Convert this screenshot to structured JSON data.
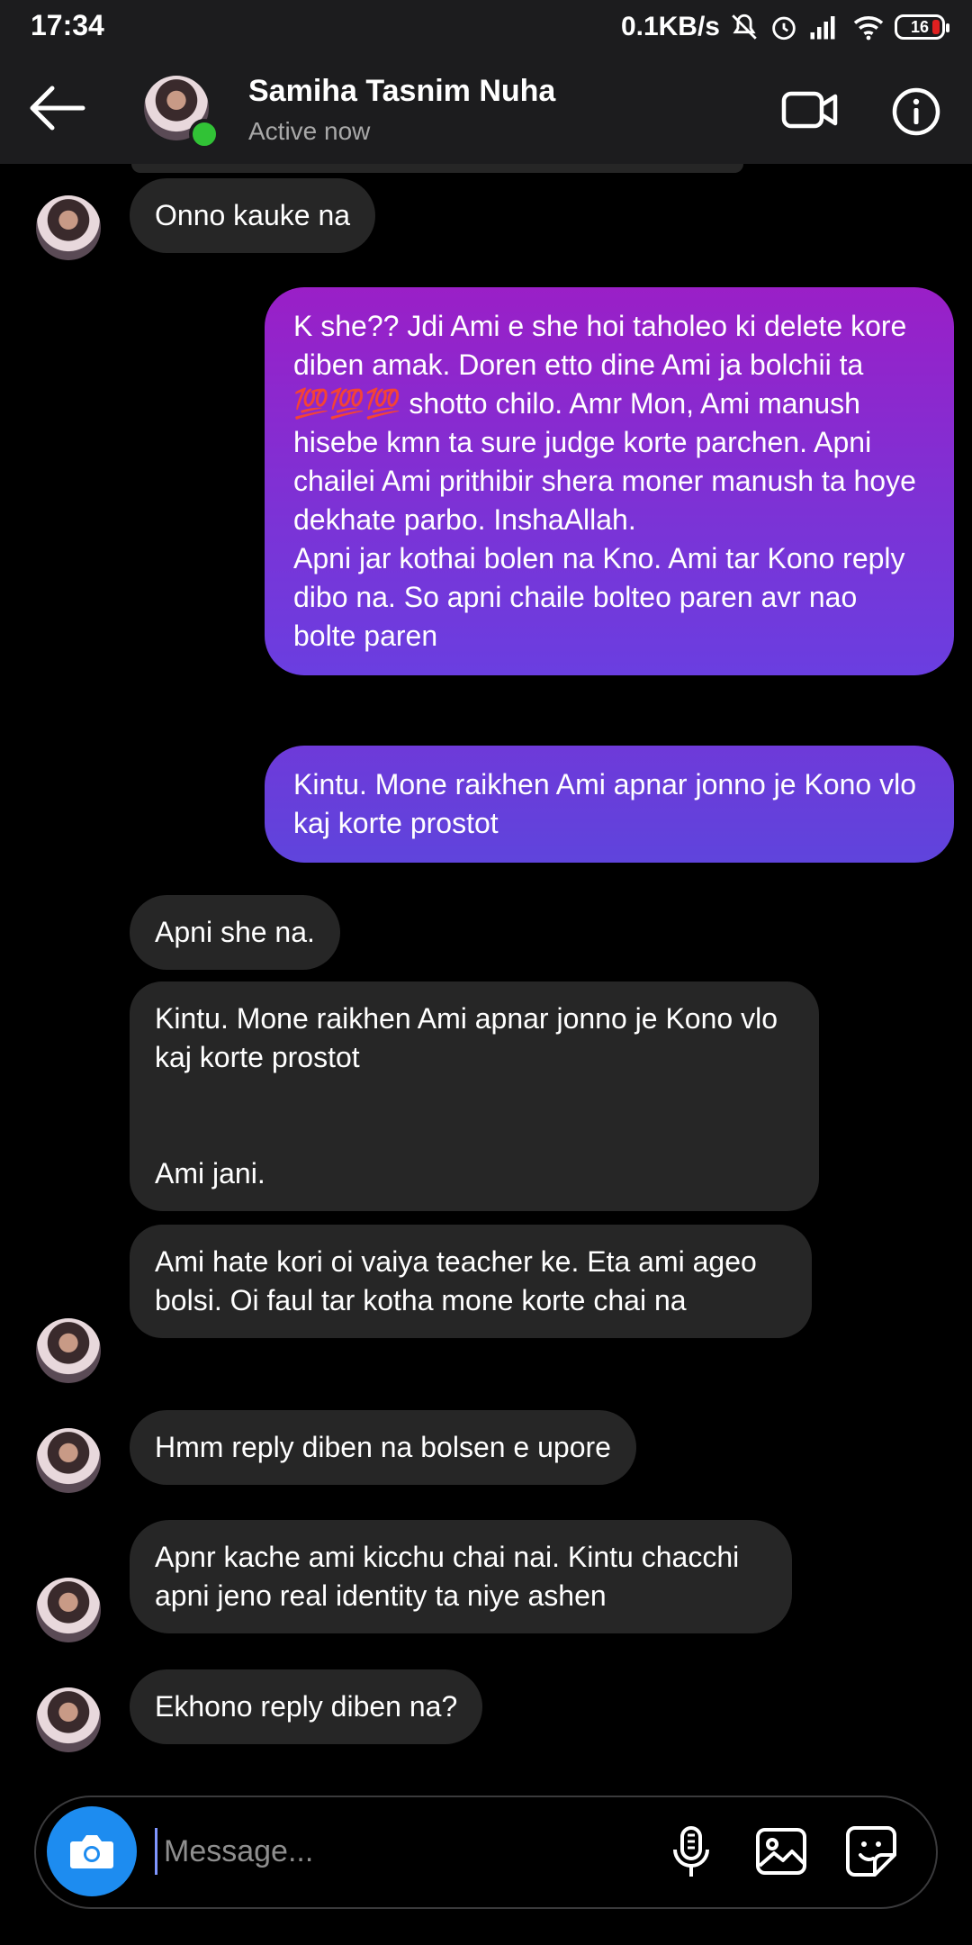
{
  "status_bar": {
    "time": "17:34",
    "network_speed": "0.1KB/s",
    "battery_level": "16",
    "icons": [
      "mute-icon",
      "alarm-icon",
      "signal-icon",
      "wifi-icon",
      "battery-icon"
    ]
  },
  "header": {
    "contact_name": "Samiha Tasnim Nuha",
    "status": "Active now",
    "icons": [
      "back-arrow-icon",
      "video-call-icon",
      "info-icon"
    ]
  },
  "messages": [
    {
      "from": "them",
      "text": "Onno kauke na"
    },
    {
      "from": "me",
      "text": "K she?? Jdi Ami e she hoi taholeo ki delete kore diben amak. Doren etto dine Ami ja bolchii ta 💯💯💯 shotto chilo. Amr Mon, Ami manush hisebe kmn ta sure judge korte parchen. Apni chailei Ami prithibir shera moner manush ta hoye dekhate parbo. InshaAllah.\nApni jar kothai bolen na Kno. Ami tar Kono reply dibo na. So apni chaile bolteo paren avr nao bolte paren"
    },
    {
      "from": "me",
      "text": "Kintu. Mone raikhen Ami apnar jonno je Kono vlo kaj korte prostot"
    },
    {
      "from": "them",
      "text": "Apni she na."
    },
    {
      "from": "them",
      "text": "Kintu. Mone raikhen Ami apnar jonno je Kono vlo kaj korte prostot\n\n\nAmi jani."
    },
    {
      "from": "them",
      "text": "Ami hate kori oi vaiya teacher ke. Eta ami ageo bolsi. Oi faul tar kotha mone korte chai na"
    },
    {
      "from": "them",
      "text": "Hmm reply diben na bolsen e upore"
    },
    {
      "from": "them",
      "text": "Apnr kache ami kicchu chai nai. Kintu chacchi apni jeno real identity ta niye ashen"
    },
    {
      "from": "them",
      "text": "Ekhono reply diben na?"
    }
  ],
  "composer": {
    "placeholder": "Message...",
    "icons": [
      "camera-icon",
      "microphone-icon",
      "gallery-icon",
      "sticker-icon"
    ]
  },
  "colors": {
    "incoming_bubble": "#262626",
    "outgoing_gradient_top": "#9a1fc7",
    "outgoing_gradient_bottom": "#6a3ee0",
    "camera_button": "#1d8cf0",
    "online_dot": "#31c236"
  }
}
